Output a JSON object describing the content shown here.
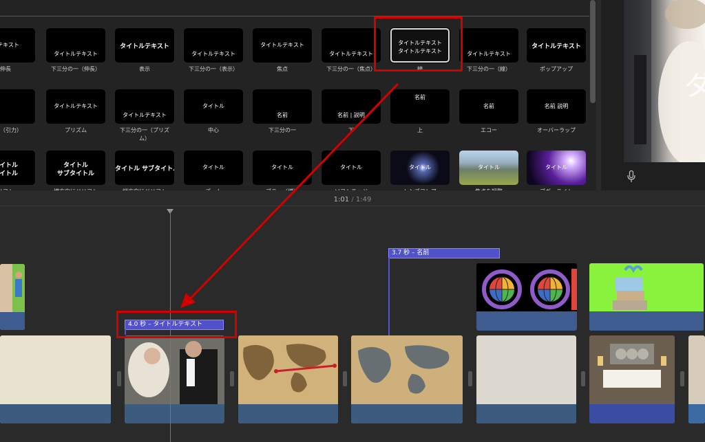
{
  "browser": {
    "row1": [
      {
        "label": "伸長",
        "text": "ルテキスト",
        "text_pos": "mid"
      },
      {
        "label": "下三分の一（伸長）",
        "text": "タイトルテキスト",
        "text_pos": "low"
      },
      {
        "label": "表示",
        "text": "タイトルテキスト",
        "text_pos": "mid",
        "big": true
      },
      {
        "label": "下三分の一（表示）",
        "text": "タイトルテキスト",
        "text_pos": "low"
      },
      {
        "label": "焦点",
        "text": "タイトルテキスト",
        "text_pos": "mid"
      },
      {
        "label": "下三分の一（焦点）",
        "text": "タイトルテキスト",
        "text_pos": "low"
      },
      {
        "label": "線",
        "text": "タイトルテキスト",
        "text2": "タイトルテキスト",
        "text_pos": "mid",
        "selected": true
      },
      {
        "label": "下三分の一（線）",
        "text": "タイトルテキスト",
        "text_pos": "low"
      },
      {
        "label": "ポップアップ",
        "text": "タイトルテキスト",
        "text_pos": "mid",
        "big": true
      }
    ],
    "row2": [
      {
        "label": "の一（引力）",
        "text": "",
        "text_pos": "low"
      },
      {
        "label": "プリズム",
        "text": "タイトルテキスト",
        "text_pos": "mid"
      },
      {
        "label": "下三分の一（プリズ",
        "label2": "ム）",
        "text": "タイトルテキスト",
        "text_pos": "low"
      },
      {
        "label": "中心",
        "text": "タイトル",
        "text_pos": "mid"
      },
      {
        "label": "下三分の一",
        "text": "名前",
        "text_pos": "low"
      },
      {
        "label": "下",
        "text": "名前 | 説明",
        "text_pos": "low"
      },
      {
        "label": "上",
        "text": "名前",
        "text_pos": "top"
      },
      {
        "label": "エコー",
        "text": "名前",
        "text_pos": "mid"
      },
      {
        "label": "オーバーラップ",
        "text": "名前 説明",
        "text_pos": "mid"
      }
    ],
    "row3": [
      {
        "label": "リフト",
        "text": "タイトル",
        "text2": "タイトル",
        "text_pos": "mid",
        "big": true
      },
      {
        "label": "横方向にドリフト",
        "text": "タイトル",
        "text2": "サブタイトル",
        "text_pos": "mid",
        "big": true
      },
      {
        "label": "縦方向にドリフト",
        "text": "タイトル サブタイトル",
        "text_pos": "mid",
        "big": true
      },
      {
        "label": "ズーム",
        "text": "タイトル",
        "text_pos": "mid"
      },
      {
        "label": "ブラー（横）",
        "text": "タイトル",
        "text_pos": "mid"
      },
      {
        "label": "ソフトエッジ",
        "text": "タイトル",
        "text_pos": "mid"
      },
      {
        "label": "レンズフレア",
        "text": "タイトル",
        "text_pos": "mid"
      },
      {
        "label": "焦点を調整",
        "text": "タイトル",
        "text_pos": "mid"
      },
      {
        "label": "ブギーライト",
        "text": "タイトル",
        "text_pos": "mid"
      }
    ]
  },
  "viewer": {
    "overlay_text": "ダ",
    "mic_icon": "microphone-icon"
  },
  "timeline": {
    "current_time": "1:01",
    "separator": "/",
    "total_time": "1:49",
    "title_clips": [
      {
        "label": "4.0 秒 – タイトルテキスト"
      },
      {
        "label": "3.7 秒 – 名前"
      }
    ]
  },
  "colors": {
    "title_bar": "#5151c9",
    "audio_band": "#3d5b7e",
    "highlight": "#d40000"
  }
}
